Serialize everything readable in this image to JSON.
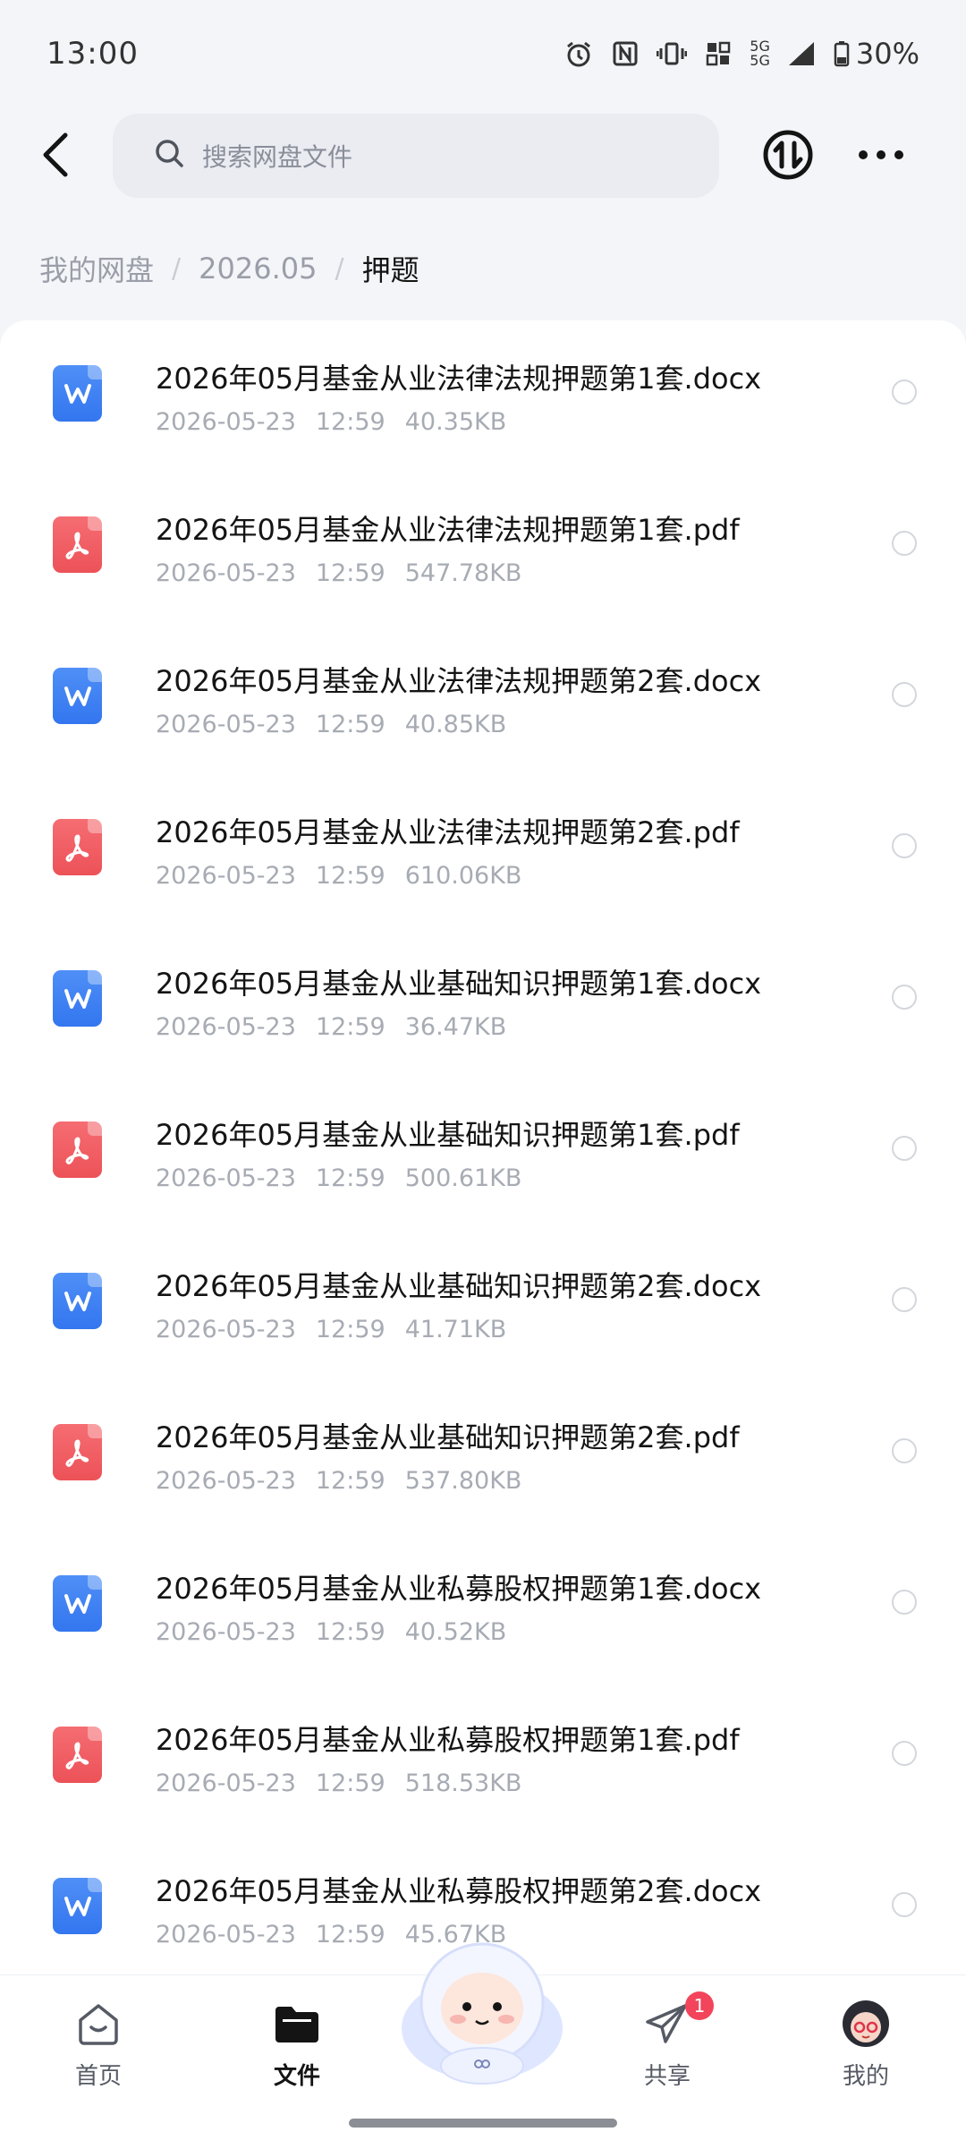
{
  "status_bar": {
    "time": "13:00",
    "network": "5G",
    "battery": "30%"
  },
  "header": {
    "search_placeholder": "搜索网盘文件"
  },
  "breadcrumb": {
    "items": [
      "我的网盘",
      "2026.05"
    ],
    "current": "押题"
  },
  "files": [
    {
      "name": "2026年05月基金从业法律法规押题第1套.docx",
      "type": "docx",
      "date": "2026-05-23",
      "time": "12:59",
      "size": "40.35KB"
    },
    {
      "name": "2026年05月基金从业法律法规押题第1套.pdf",
      "type": "pdf",
      "date": "2026-05-23",
      "time": "12:59",
      "size": "547.78KB"
    },
    {
      "name": "2026年05月基金从业法律法规押题第2套.docx",
      "type": "docx",
      "date": "2026-05-23",
      "time": "12:59",
      "size": "40.85KB"
    },
    {
      "name": "2026年05月基金从业法律法规押题第2套.pdf",
      "type": "pdf",
      "date": "2026-05-23",
      "time": "12:59",
      "size": "610.06KB"
    },
    {
      "name": "2026年05月基金从业基础知识押题第1套.docx",
      "type": "docx",
      "date": "2026-05-23",
      "time": "12:59",
      "size": "36.47KB"
    },
    {
      "name": "2026年05月基金从业基础知识押题第1套.pdf",
      "type": "pdf",
      "date": "2026-05-23",
      "time": "12:59",
      "size": "500.61KB"
    },
    {
      "name": "2026年05月基金从业基础知识押题第2套.docx",
      "type": "docx",
      "date": "2026-05-23",
      "time": "12:59",
      "size": "41.71KB"
    },
    {
      "name": "2026年05月基金从业基础知识押题第2套.pdf",
      "type": "pdf",
      "date": "2026-05-23",
      "time": "12:59",
      "size": "537.80KB"
    },
    {
      "name": "2026年05月基金从业私募股权押题第1套.docx",
      "type": "docx",
      "date": "2026-05-23",
      "time": "12:59",
      "size": "40.52KB"
    },
    {
      "name": "2026年05月基金从业私募股权押题第1套.pdf",
      "type": "pdf",
      "date": "2026-05-23",
      "time": "12:59",
      "size": "518.53KB"
    },
    {
      "name": "2026年05月基金从业私募股权押题第2套.docx",
      "type": "docx",
      "date": "2026-05-23",
      "time": "12:59",
      "size": "45.67KB"
    }
  ],
  "bottom_nav": {
    "home": "首页",
    "files": "文件",
    "share": "共享",
    "share_badge": "1",
    "me": "我的"
  },
  "colors": {
    "word_icon": "#3f82f4",
    "pdf_icon": "#f05f65",
    "badge": "#f2445a"
  }
}
